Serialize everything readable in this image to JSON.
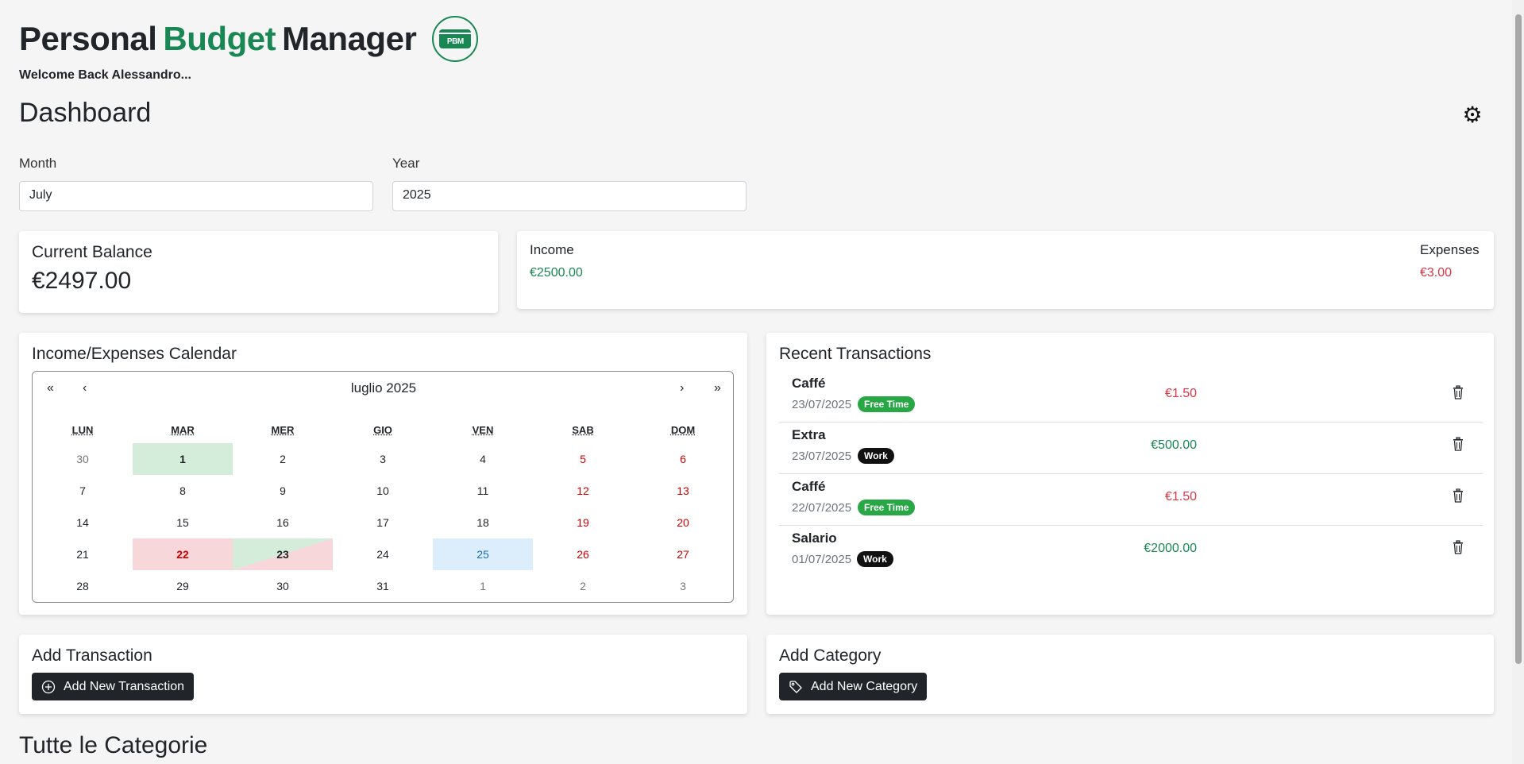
{
  "brand": {
    "part1": "Personal",
    "part2": "Budget",
    "part3": "Manager",
    "logo_text": "PBM"
  },
  "welcome": "Welcome Back Alessandro...",
  "page_title": "Dashboard",
  "filters": {
    "month_label": "Month",
    "month_value": "July",
    "year_label": "Year",
    "year_value": "2025"
  },
  "balance": {
    "title": "Current Balance",
    "value": "€2497.00"
  },
  "summary": {
    "income_label": "Income",
    "income_value": "€2500.00",
    "expenses_label": "Expenses",
    "expenses_value": "€3.00"
  },
  "calendar": {
    "title": "Income/Expenses Calendar",
    "month_label": "luglio 2025",
    "nav": {
      "prev_year": "«",
      "prev_month": "‹",
      "next_month": "›",
      "next_year": "»"
    },
    "weekdays": [
      "LUN",
      "MAR",
      "MER",
      "GIO",
      "VEN",
      "SAB",
      "DOM"
    ],
    "weeks": [
      [
        "30",
        "1",
        "2",
        "3",
        "4",
        "5",
        "6"
      ],
      [
        "7",
        "8",
        "9",
        "10",
        "11",
        "12",
        "13"
      ],
      [
        "14",
        "15",
        "16",
        "17",
        "18",
        "19",
        "20"
      ],
      [
        "21",
        "22",
        "23",
        "24",
        "25",
        "26",
        "27"
      ],
      [
        "28",
        "29",
        "30",
        "31",
        "1",
        "2",
        "3"
      ]
    ]
  },
  "transactions": {
    "title": "Recent Transactions",
    "items": [
      {
        "name": "Caffé",
        "date": "23/07/2025",
        "category": "Free Time",
        "amount": "€1.50",
        "type": "expense"
      },
      {
        "name": "Extra",
        "date": "23/07/2025",
        "category": "Work",
        "amount": "€500.00",
        "type": "income"
      },
      {
        "name": "Caffé",
        "date": "22/07/2025",
        "category": "Free Time",
        "amount": "€1.50",
        "type": "expense"
      },
      {
        "name": "Salario",
        "date": "01/07/2025",
        "category": "Work",
        "amount": "€2000.00",
        "type": "income"
      }
    ]
  },
  "add_transaction": {
    "title": "Add Transaction",
    "button": "Add New Transaction"
  },
  "add_category": {
    "title": "Add Category",
    "button": "Add New Category"
  },
  "categories_title": "Tutte le Categorie",
  "colors": {
    "accent": "#198754",
    "expense": "#dc3545",
    "free_time_badge": "#28a745",
    "work_badge": "#111111",
    "dark_button": "#212529"
  },
  "icons": {
    "settings": "gear-icon",
    "delete": "trash-icon",
    "add": "plus-circle-icon",
    "tag": "tag-icon"
  }
}
